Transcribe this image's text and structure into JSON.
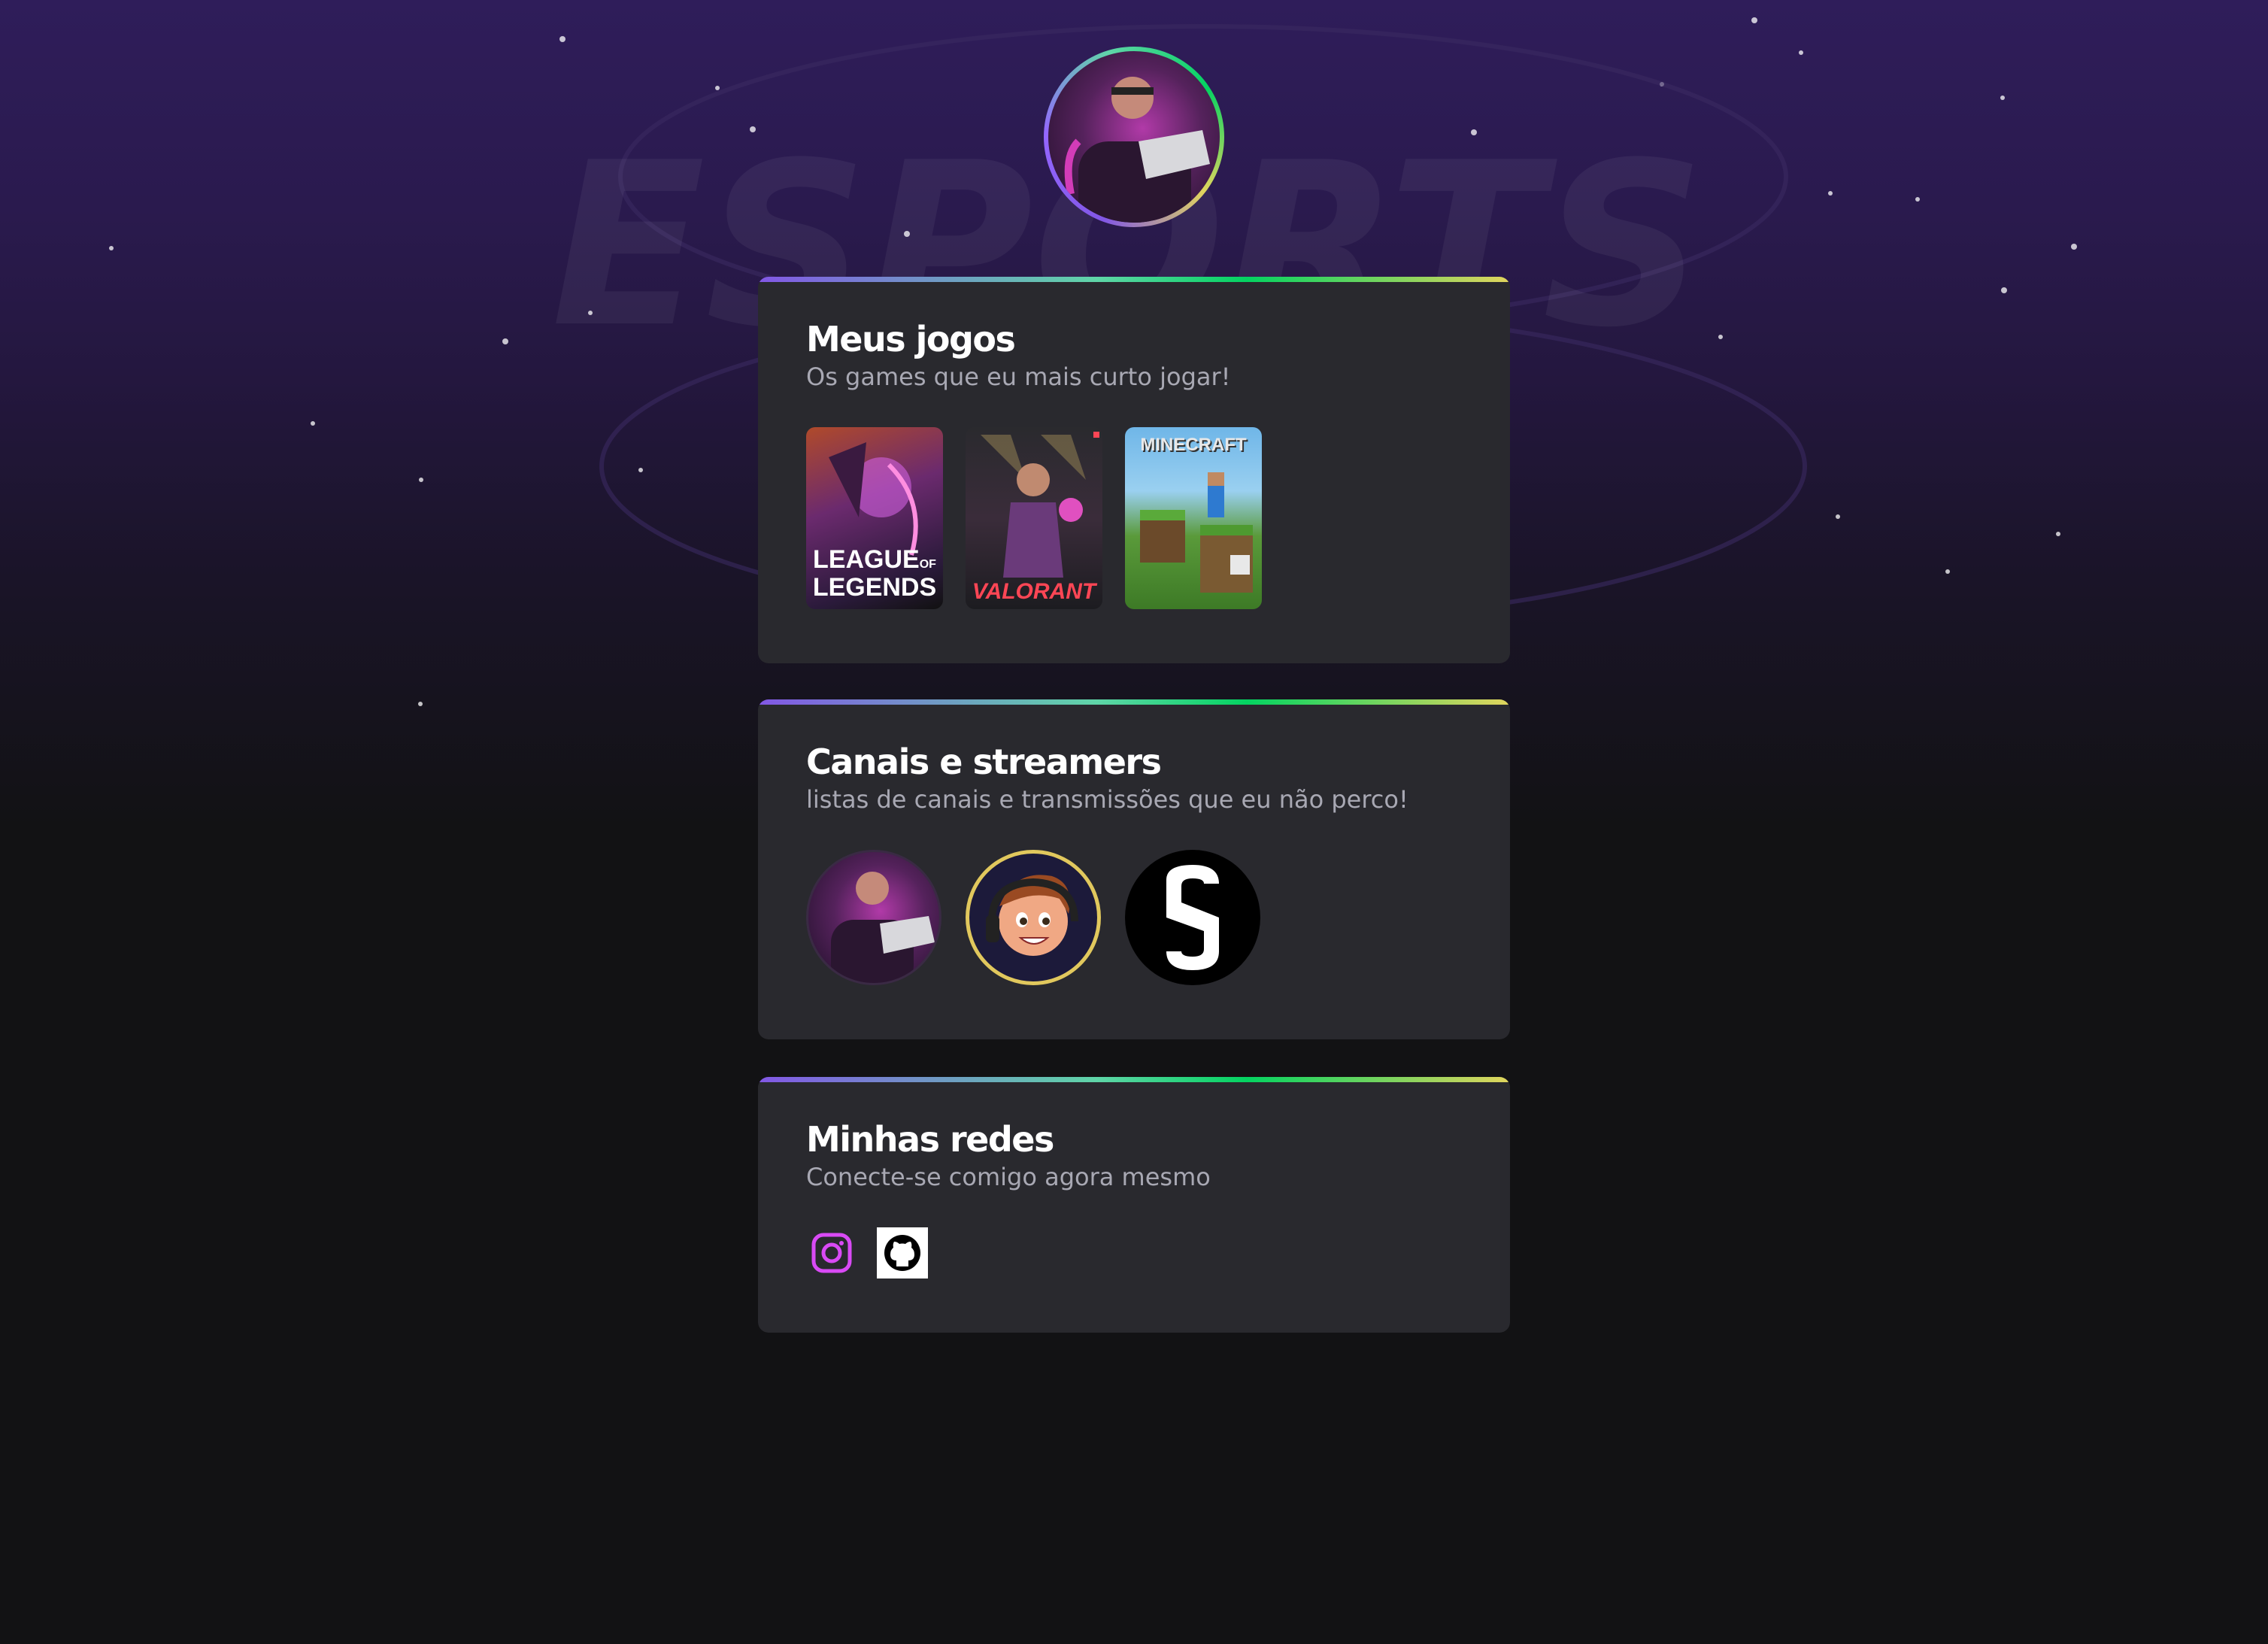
{
  "profile": {
    "avatar_alt": "profile-photo"
  },
  "games": {
    "title": "Meus jogos",
    "subtitle": "Os games que eu mais curto jogar!",
    "items": [
      {
        "name": "LEAGUE OF LEGENDS",
        "label_line1": "LEAGUE",
        "label_of": "OF",
        "label_line2": "LEGENDS"
      },
      {
        "name": "VALORANT",
        "label": "VALORANT"
      },
      {
        "name": "MINECRAFT",
        "label": "MINECRAFT"
      }
    ]
  },
  "channels": {
    "title": "Canais e streamers",
    "subtitle": "listas de canais e transmissões que eu não perco!",
    "items": [
      {
        "icon": "streamer-avatar-1"
      },
      {
        "icon": "streamer-avatar-cartoon"
      },
      {
        "icon": "streamer-logo-s"
      }
    ]
  },
  "social": {
    "title": "Minhas redes",
    "subtitle": "Conecte-se comigo agora mesmo",
    "items": [
      {
        "icon": "instagram-icon",
        "color": "#d94af5"
      },
      {
        "icon": "github-icon",
        "color": "#000000"
      }
    ]
  },
  "colors": {
    "background": "#121214",
    "card": "#29292e",
    "subtitle": "#a8a8b3",
    "gradient": [
      "#8257e5",
      "#5fd5a8",
      "#04d361",
      "#e1d55d"
    ]
  }
}
